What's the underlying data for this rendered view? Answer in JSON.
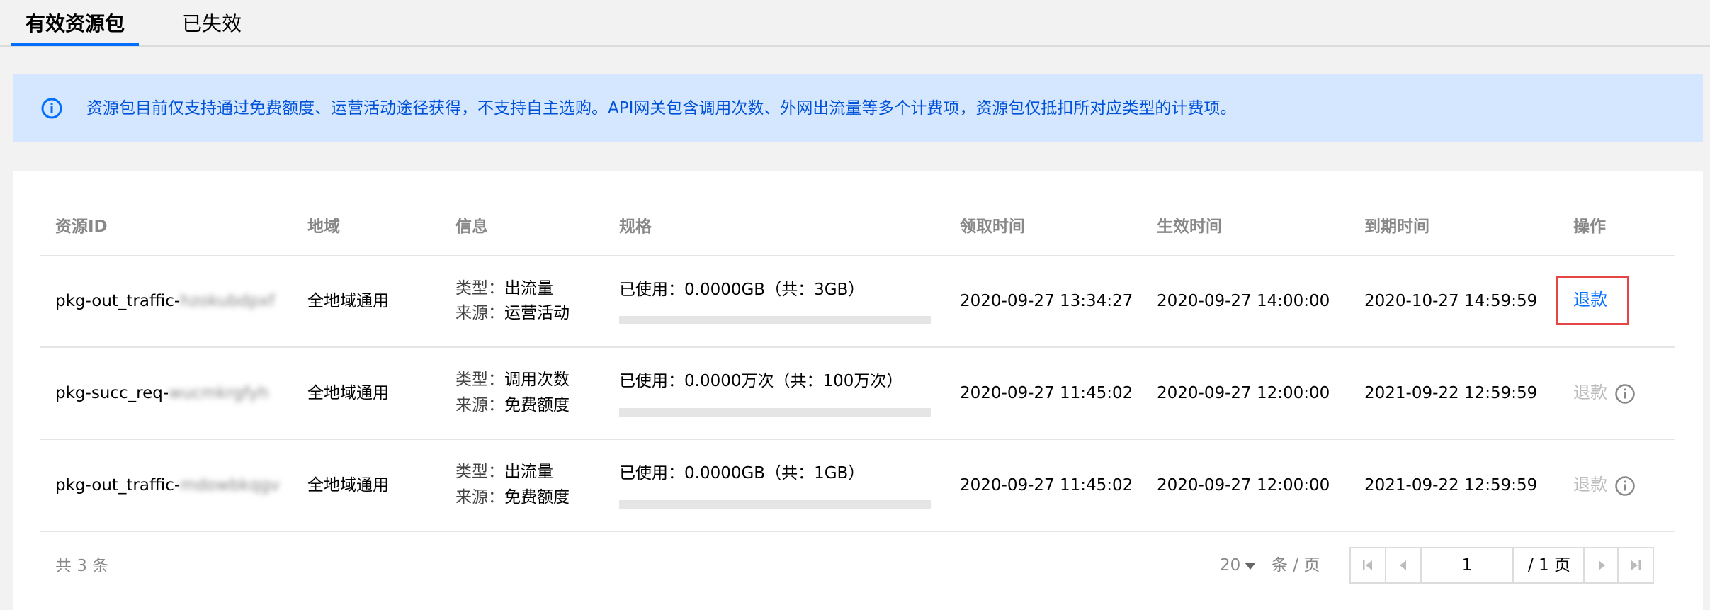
{
  "tabs": {
    "active": "有效资源包",
    "inactive": "已失效"
  },
  "notice": {
    "text": "资源包目前仅支持通过免费额度、运营活动途径获得，不支持自主选购。API网关包含调用次数、外网出流量等多个计费项，资源包仅抵扣所对应类型的计费项。"
  },
  "table": {
    "headers": {
      "id": "资源ID",
      "region": "地域",
      "info": "信息",
      "spec": "规格",
      "claim": "领取时间",
      "effective": "生效时间",
      "expire": "到期时间",
      "action": "操作"
    },
    "rows": [
      {
        "id_prefix": "pkg-out_traffic-",
        "id_suffix": "hzokubdpxf",
        "region": "全地域通用",
        "type_label": "类型：",
        "type": "出流量",
        "source_label": "来源：",
        "source": "运营活动",
        "spec": "已使用：0.0000GB（共：3GB）",
        "usage_fraction": 0,
        "claim": "2020-09-27 13:34:27",
        "effective": "2020-09-27 14:00:00",
        "expire": "2020-10-27 14:59:59",
        "action": "退款",
        "action_enabled": true
      },
      {
        "id_prefix": "pkg-succ_req-",
        "id_suffix": "wucmkrgfyh",
        "region": "全地域通用",
        "type_label": "类型：",
        "type": "调用次数",
        "source_label": "来源：",
        "source": "免费额度",
        "spec": "已使用：0.0000万次（共：100万次）",
        "usage_fraction": 0,
        "claim": "2020-09-27 11:45:02",
        "effective": "2020-09-27 12:00:00",
        "expire": "2021-09-22 12:59:59",
        "action": "退款",
        "action_enabled": false
      },
      {
        "id_prefix": "pkg-out_traffic-",
        "id_suffix": "mdowbkqgv",
        "region": "全地域通用",
        "type_label": "类型：",
        "type": "出流量",
        "source_label": "来源：",
        "source": "免费额度",
        "spec": "已使用：0.0000GB（共：1GB）",
        "usage_fraction": 0,
        "claim": "2020-09-27 11:45:02",
        "effective": "2020-09-27 12:00:00",
        "expire": "2021-09-22 12:59:59",
        "action": "退款",
        "action_enabled": false
      }
    ]
  },
  "pagination": {
    "total": "共 3 条",
    "page_size": "20",
    "per_page": "条 / 页",
    "current_page": "1",
    "total_pages": "/ 1 页"
  },
  "colors": {
    "accent": "#006eff",
    "notice_bg": "#d5e7ff",
    "highlight_border": "#e54545"
  },
  "icons": {
    "notice": "info-circle-icon",
    "help": "question-circle-icon",
    "first": "first-page-icon",
    "prev": "prev-page-icon",
    "next": "next-page-icon",
    "last": "last-page-icon",
    "dropdown": "caret-down-icon"
  }
}
